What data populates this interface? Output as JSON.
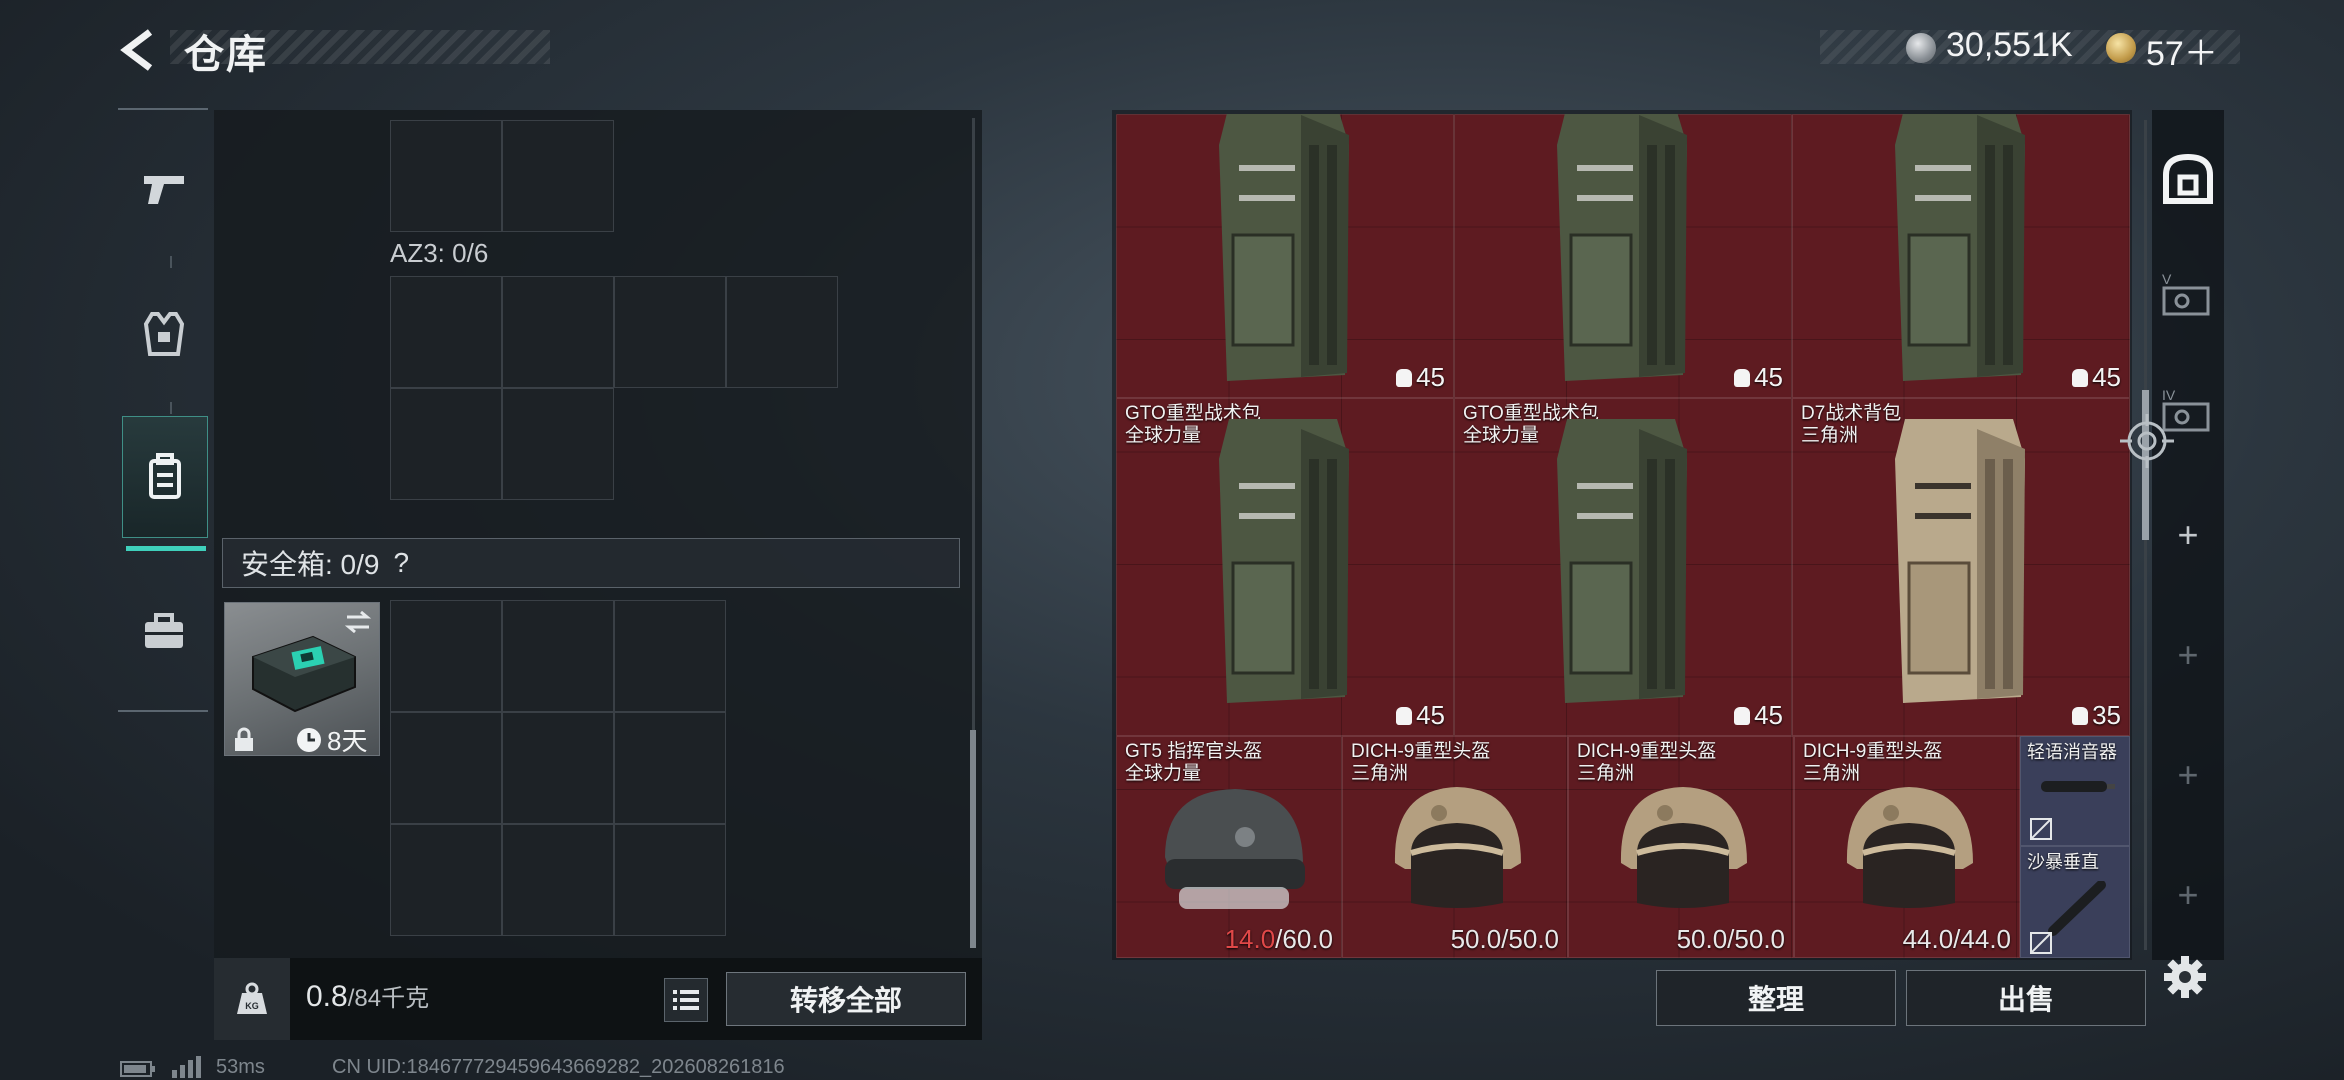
{
  "header": {
    "title": "仓库",
    "currency_silver": "30,551K",
    "currency_gold": "57＋"
  },
  "left_panel": {
    "az3_label": "AZ3: 0/6",
    "safe_box_label": "安全箱: 0/9",
    "safe_box_help": "?",
    "safe_box_item": {
      "days": "8天"
    },
    "weight": {
      "current": "0.8",
      "max": "/84千克"
    },
    "transfer_all": "转移全部"
  },
  "stash": {
    "items": [
      {
        "name": "",
        "sub": "",
        "cap": "45"
      },
      {
        "name": "",
        "sub": "",
        "cap": "45"
      },
      {
        "name": "",
        "sub": "",
        "cap": "45"
      },
      {
        "name": "GTO重型战术包",
        "sub": "全球力量",
        "cap": "45"
      },
      {
        "name": "GTO重型战术包",
        "sub": "全球力量",
        "cap": "45"
      },
      {
        "name": "D7战术背包",
        "sub": "三角洲",
        "cap": "35"
      }
    ],
    "helmets": [
      {
        "name": "GT5 指挥官头盔",
        "sub": "全球力量",
        "cur": "14.0",
        "max": "/60.0",
        "low": true
      },
      {
        "name": "DICH-9重型头盔",
        "sub": "三角洲",
        "cur": "50.0",
        "max": "/50.0",
        "low": false
      },
      {
        "name": "DICH-9重型头盔",
        "sub": "三角洲",
        "cur": "50.0",
        "max": "/50.0",
        "low": false
      },
      {
        "name": "DICH-9重型头盔",
        "sub": "三角洲",
        "cur": "44.0",
        "max": "/44.0",
        "low": false
      }
    ],
    "small_items": [
      {
        "name": "轻语消音器"
      },
      {
        "name": "沙暴垂直"
      }
    ],
    "btn_sort": "整理",
    "btn_sell": "出售"
  },
  "footer": {
    "ping": "53ms",
    "uid": "CN UID:184677729459643669282_202608261816"
  }
}
